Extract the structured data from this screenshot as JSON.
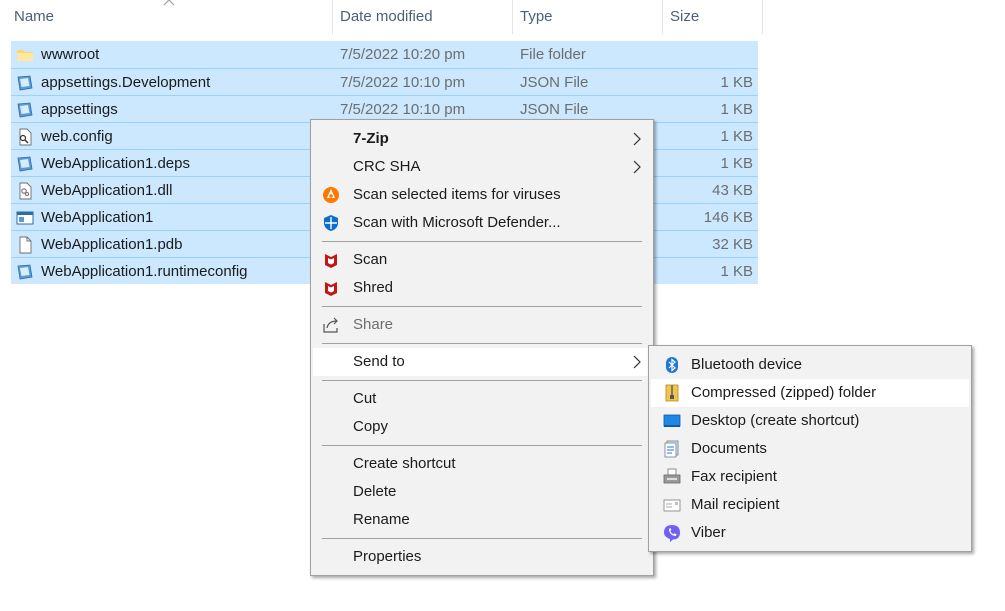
{
  "columns": {
    "name": "Name",
    "date_modified": "Date modified",
    "type": "Type",
    "size": "Size"
  },
  "files": [
    {
      "name": "wwwroot",
      "date": "7/5/2022 10:20 pm",
      "type": "File folder",
      "size": "",
      "icon": "folder-icon"
    },
    {
      "name": "appsettings.Development",
      "date": "7/5/2022 10:10 pm",
      "type": "JSON File",
      "size": "1 KB",
      "icon": "json-file-icon"
    },
    {
      "name": "appsettings",
      "date": "7/5/2022 10:10 pm",
      "type": "JSON File",
      "size": "1 KB",
      "icon": "json-file-icon"
    },
    {
      "name": "web.config",
      "date": "",
      "type": "",
      "size": "1 KB",
      "icon": "config-file-icon"
    },
    {
      "name": "WebApplication1.deps",
      "date": "",
      "type": "",
      "size": "1 KB",
      "icon": "json-file-icon"
    },
    {
      "name": "WebApplication1.dll",
      "date": "",
      "type": "",
      "size": "43 KB",
      "icon": "dll-file-icon"
    },
    {
      "name": "WebApplication1",
      "date": "",
      "type": "",
      "size": "146 KB",
      "icon": "exe-file-icon"
    },
    {
      "name": "WebApplication1.pdb",
      "date": "",
      "type": "",
      "size": "32 KB",
      "icon": "blank-file-icon"
    },
    {
      "name": "WebApplication1.runtimeconfig",
      "date": "",
      "type": "",
      "size": "1 KB",
      "icon": "json-file-icon"
    }
  ],
  "context_menu": {
    "seven_zip": "7-Zip",
    "crc_sha": "CRC SHA",
    "scan_viruses": "Scan selected items for viruses",
    "scan_defender": "Scan with Microsoft Defender...",
    "scan": "Scan",
    "shred": "Shred",
    "share": "Share",
    "send_to": "Send to",
    "cut": "Cut",
    "copy": "Copy",
    "create_shortcut": "Create shortcut",
    "delete": "Delete",
    "rename": "Rename",
    "properties": "Properties"
  },
  "send_to_menu": {
    "bluetooth": "Bluetooth device",
    "compressed": "Compressed (zipped) folder",
    "desktop": "Desktop (create shortcut)",
    "documents": "Documents",
    "fax": "Fax recipient",
    "mail": "Mail recipient",
    "viber": "Viber"
  },
  "colors": {
    "selection": "#cce8ff",
    "menu_bg": "#f2f2f2",
    "menu_highlight": "#ffffff",
    "header_text": "#4c607a"
  }
}
